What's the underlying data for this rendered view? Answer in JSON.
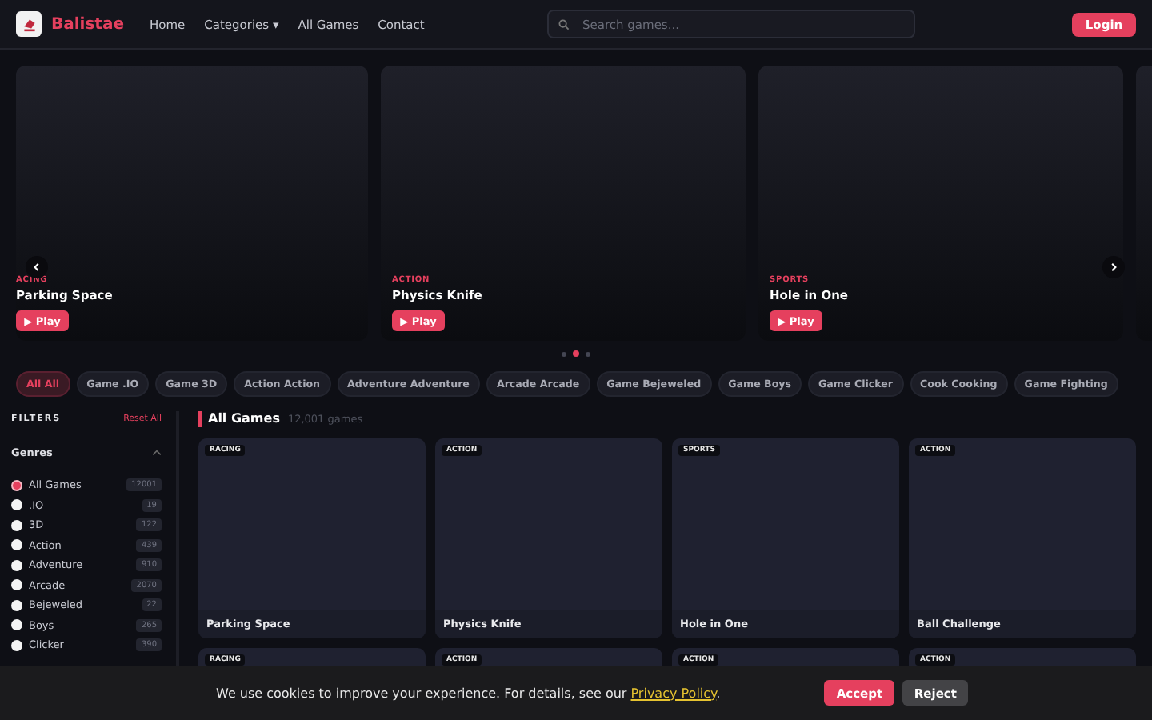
{
  "header": {
    "brand": "Balistae",
    "nav": [
      {
        "label": "Home",
        "kind": "link"
      },
      {
        "label": "Categories ▾",
        "kind": "link"
      },
      {
        "label": "All Games",
        "kind": "link"
      },
      {
        "label": "Contact",
        "kind": "link"
      }
    ],
    "search": {
      "placeholder": "Search games..."
    },
    "login": "Login"
  },
  "carousel": {
    "slides": [
      {
        "category": "ACING",
        "title": "Parking Space",
        "play": "▶ Play"
      },
      {
        "category": "ACTION",
        "title": "Physics Knife",
        "play": "▶ Play"
      },
      {
        "category": "SPORTS",
        "title": "Hole in One",
        "play": "▶ Play"
      }
    ],
    "dots": [
      {
        "selected": false
      },
      {
        "selected": true
      },
      {
        "selected": false
      }
    ]
  },
  "categories": [
    {
      "label": "All All",
      "selected": true
    },
    {
      "label": "Game .IO",
      "selected": false
    },
    {
      "label": "Game 3D",
      "selected": false
    },
    {
      "label": "Action Action",
      "selected": false
    },
    {
      "label": "Adventure Adventure",
      "selected": false
    },
    {
      "label": "Arcade Arcade",
      "selected": false
    },
    {
      "label": "Game Bejeweled",
      "selected": false
    },
    {
      "label": "Game Boys",
      "selected": false
    },
    {
      "label": "Game Clicker",
      "selected": false
    },
    {
      "label": "Cook Cooking",
      "selected": false
    },
    {
      "label": "Game Fighting",
      "selected": false
    }
  ],
  "filters": {
    "title": "FILTERS",
    "reset": "Reset All",
    "section": "Genres",
    "genres": [
      {
        "label": "All Games",
        "count": "12001",
        "selected": true
      },
      {
        "label": ".IO",
        "count": "19",
        "selected": false
      },
      {
        "label": "3D",
        "count": "122",
        "selected": false
      },
      {
        "label": "Action",
        "count": "439",
        "selected": false
      },
      {
        "label": "Adventure",
        "count": "910",
        "selected": false
      },
      {
        "label": "Arcade",
        "count": "2070",
        "selected": false
      },
      {
        "label": "Bejeweled",
        "count": "22",
        "selected": false
      },
      {
        "label": "Boys",
        "count": "265",
        "selected": false
      },
      {
        "label": "Clicker",
        "count": "390",
        "selected": false
      }
    ]
  },
  "games": {
    "title": "All Games",
    "count": "12,001 games",
    "items": [
      {
        "category": "RACING",
        "title": "Parking Space"
      },
      {
        "category": "ACTION",
        "title": "Physics Knife"
      },
      {
        "category": "SPORTS",
        "title": "Hole in One"
      },
      {
        "category": "ACTION",
        "title": "Ball Challenge"
      },
      {
        "category": "RACING"
      },
      {
        "category": "ACTION"
      },
      {
        "category": "ACTION"
      },
      {
        "category": "ACTION"
      }
    ]
  },
  "cookie": {
    "text": "We use cookies to improve your experience. For details, see our ",
    "link": "Privacy Policy",
    "end": ".",
    "accept": "Accept",
    "reject": "Reject"
  }
}
